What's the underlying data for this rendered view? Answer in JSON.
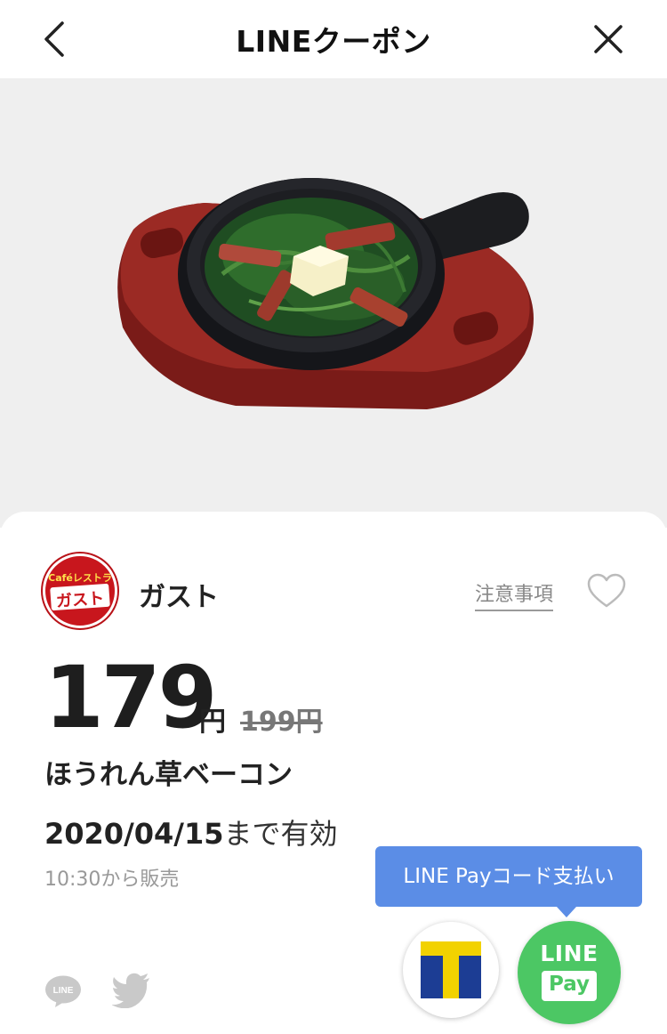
{
  "header": {
    "title": "LINEクーポン",
    "back_icon": "chevron-left-icon",
    "close_icon": "close-icon"
  },
  "hero": {
    "image": "spinach-bacon-skillet-photo"
  },
  "shop": {
    "logo_top": "Caféレストラン",
    "logo_word": "ガスト",
    "name": "ガスト",
    "notes_link": "注意事項",
    "favorite_icon": "heart-icon"
  },
  "coupon": {
    "price": "179",
    "currency": "円",
    "original_price": "199円",
    "item_name": "ほうれん草ベーコン",
    "valid_date": "2020/04/15",
    "valid_suffix": "まで有効",
    "sale_time": "10:30から販売"
  },
  "share": {
    "line_icon": "line-share-icon",
    "line_label": "LINE",
    "twitter_icon": "twitter-icon"
  },
  "payment": {
    "tooltip": "LINE Payコード支払い",
    "tpoint_icon": "t-point-icon",
    "linepay_line1": "LINE",
    "linepay_line2": "Pay"
  },
  "colors": {
    "accent_blue": "#5b8de6",
    "line_green": "#4cc764",
    "gusto_red": "#c8161d"
  }
}
